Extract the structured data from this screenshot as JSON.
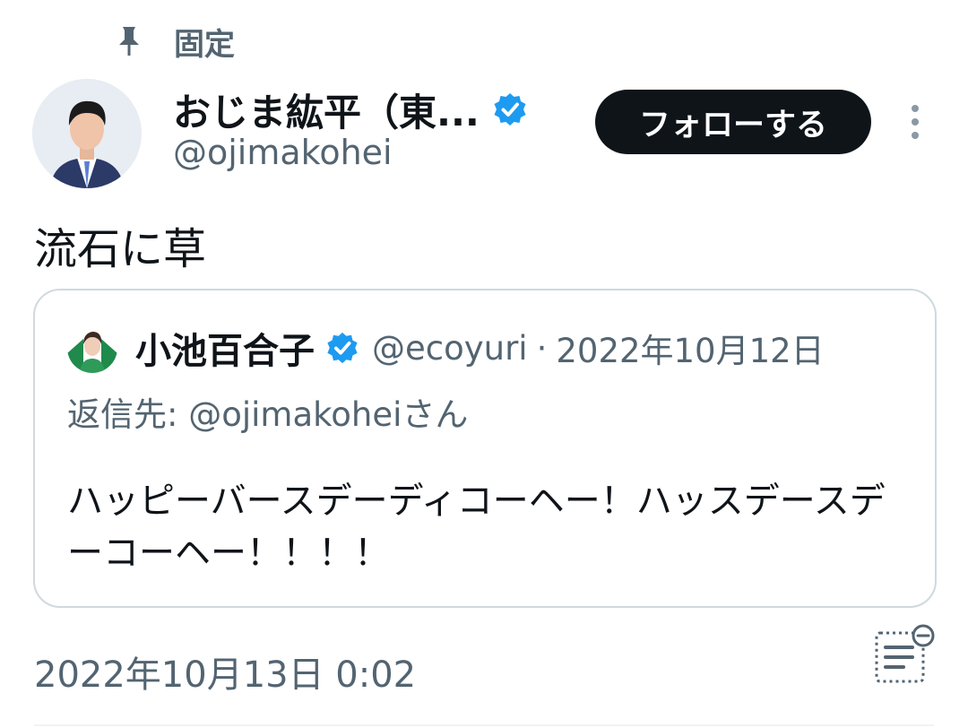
{
  "pinned": {
    "label": "固定",
    "icon": "pin-icon"
  },
  "author": {
    "display_name": "おじま紘平（東...",
    "handle": "@ojimakohei",
    "verified": true,
    "verified_color": "#1d9bf0"
  },
  "follow_button": {
    "label": "フォローする"
  },
  "more_menu": {
    "icon": "more-vertical-icon"
  },
  "tweet": {
    "text": "流石に草",
    "timestamp": "2022年10月13日 0:02"
  },
  "quote": {
    "display_name": "小池百合子",
    "verified": true,
    "handle": "@ecoyuri",
    "separator": "·",
    "date": "2022年10月12日",
    "reply_to": "返信先: @ojimakoheiさん",
    "text": "ハッピーバースデーディコーヘー！ハッスデースデーコーヘー！！！！"
  },
  "notes": {
    "icon": "notes-icon"
  },
  "colors": {
    "text_primary": "#0f1419",
    "text_secondary": "#536471",
    "border": "#cfd9de",
    "button_bg": "#0f1419",
    "button_text": "#ffffff"
  }
}
